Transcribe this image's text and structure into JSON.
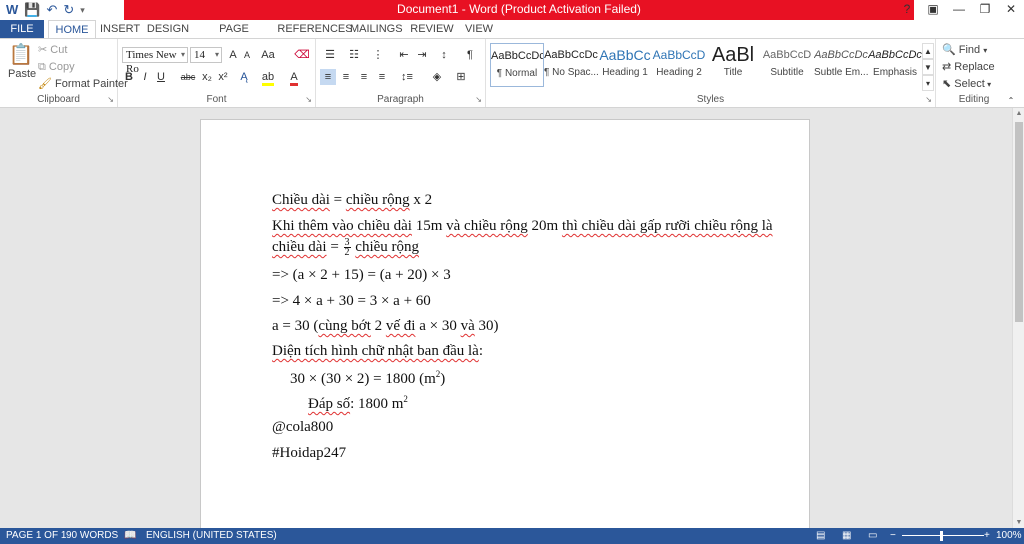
{
  "window": {
    "title": "Document1 - Word (Product Activation Failed)",
    "controls": [
      "?",
      "▣",
      "—",
      "❐",
      "✕"
    ]
  },
  "tabs": [
    "FILE",
    "HOME",
    "INSERT",
    "DESIGN",
    "PAGE LAYOUT",
    "REFERENCES",
    "MAILINGS",
    "REVIEW",
    "VIEW"
  ],
  "clipboard": {
    "paste": "Paste",
    "cut": "Cut",
    "copy": "Copy",
    "format_painter": "Format Painter",
    "label": "Clipboard"
  },
  "font": {
    "name": "Times New Ro",
    "size": "14",
    "label": "Font",
    "grow": "A",
    "shrink": "A",
    "case": "Aa",
    "bold": "B",
    "italic": "I",
    "underline": "U",
    "strike": "abc",
    "sub": "x₂",
    "sup": "x²",
    "color": "A"
  },
  "paragraph": {
    "label": "Paragraph",
    "pilcrow": "¶"
  },
  "styles": {
    "label": "Styles",
    "items": [
      {
        "preview": "AaBbCcDc",
        "name": "¶ Normal"
      },
      {
        "preview": "AaBbCcDc",
        "name": "¶ No Spac..."
      },
      {
        "preview": "AaBbCc",
        "name": "Heading 1"
      },
      {
        "preview": "AaBbCcD",
        "name": "Heading 2"
      },
      {
        "preview": "AaBl",
        "name": "Title"
      },
      {
        "preview": "AaBbCcD",
        "name": "Subtitle"
      },
      {
        "preview": "AaBbCcDc",
        "name": "Subtle Em..."
      },
      {
        "preview": "AaBbCcDc",
        "name": "Emphasis"
      }
    ]
  },
  "editing": {
    "find": "Find",
    "replace": "Replace",
    "select": "Select",
    "label": "Editing"
  },
  "document": {
    "l1": {
      "a": "Chiều dài",
      "b": " = ",
      "c": "chiều rộng",
      "d": " x 2"
    },
    "l2": {
      "a": "Khi thêm vào chiều dài",
      "b": " 15m ",
      "c": "và chiều rộng",
      "d": " 20m ",
      "e": "thì chiều dài gấp rưỡi chiều rộng là"
    },
    "l3": {
      "a": "chiều dài",
      "b": " = ",
      "num": "3",
      "den": "2",
      "c": " ",
      "d": "chiều rộng"
    },
    "l4": "=> (a × 2 + 15) = (a + 20) × 3",
    "l5": "=> 4 × a + 30 = 3 × a + 60",
    "l6": {
      "a": "a = 30 (",
      "b": "cùng bớt",
      "c": " 2 ",
      "d": "vế đi",
      "e": " a × 30 ",
      "f": "và",
      "g": " 30)"
    },
    "l7": {
      "a": "Diện tích hình chữ nhật ban đầu là",
      "b": ":"
    },
    "l8": {
      "a": "30 × (30 × 2) = 1800 (m",
      "sup": "2",
      "b": ")"
    },
    "l9": {
      "a": "Đáp số",
      "b": ": 1800 m",
      "sup": "2"
    },
    "l10": "@cola800",
    "l11": "#Hoidap247"
  },
  "status": {
    "page": "PAGE 1 OF 1",
    "words": "90 WORDS",
    "language": "ENGLISH (UNITED STATES)",
    "zoom": "100%"
  }
}
